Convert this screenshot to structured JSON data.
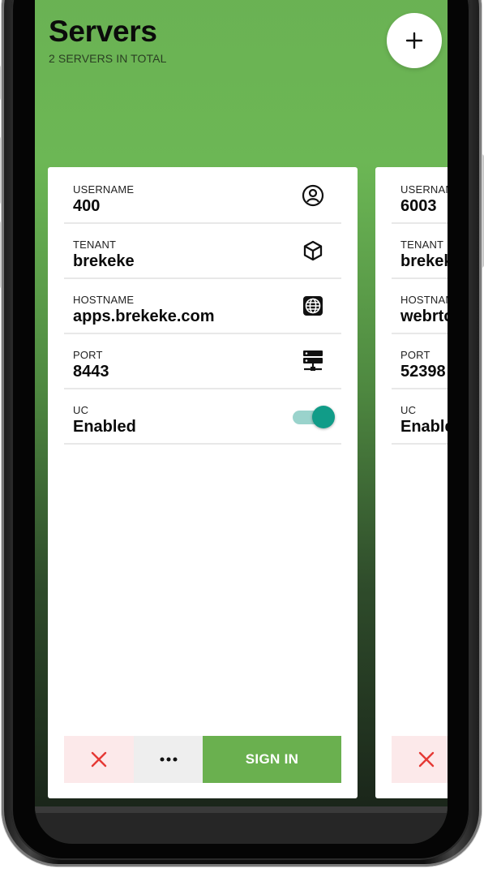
{
  "header": {
    "title": "Servers",
    "subtitle": "2 SERVERS IN TOTAL",
    "add_icon": "plus-icon"
  },
  "servers": [
    {
      "fields": [
        {
          "label": "USERNAME",
          "value": "400",
          "icon": "user-circle-icon"
        },
        {
          "label": "TENANT",
          "value": "brekeke",
          "icon": "cube-icon"
        },
        {
          "label": "HOSTNAME",
          "value": "apps.brekeke.com",
          "icon": "globe-icon"
        },
        {
          "label": "PORT",
          "value": "8443",
          "icon": "server-icon"
        },
        {
          "label": "UC",
          "value": "Enabled",
          "icon": "toggle"
        }
      ],
      "uc_enabled": true,
      "actions": {
        "delete_icon": "close-icon",
        "more_icon": "more-icon",
        "signin_label": "SIGN IN"
      }
    },
    {
      "fields": [
        {
          "label": "USERNAME",
          "value": "6003"
        },
        {
          "label": "TENANT",
          "value": "brekeke"
        },
        {
          "label": "HOSTNAME",
          "value": "webrtc"
        },
        {
          "label": "PORT",
          "value": "52398"
        },
        {
          "label": "UC",
          "value": "Enabled"
        }
      ],
      "actions": {
        "delete_icon": "close-icon"
      }
    }
  ],
  "colors": {
    "accent_green": "#6ab04f",
    "toggle_on": "#119c88",
    "delete_red": "#e53935"
  }
}
